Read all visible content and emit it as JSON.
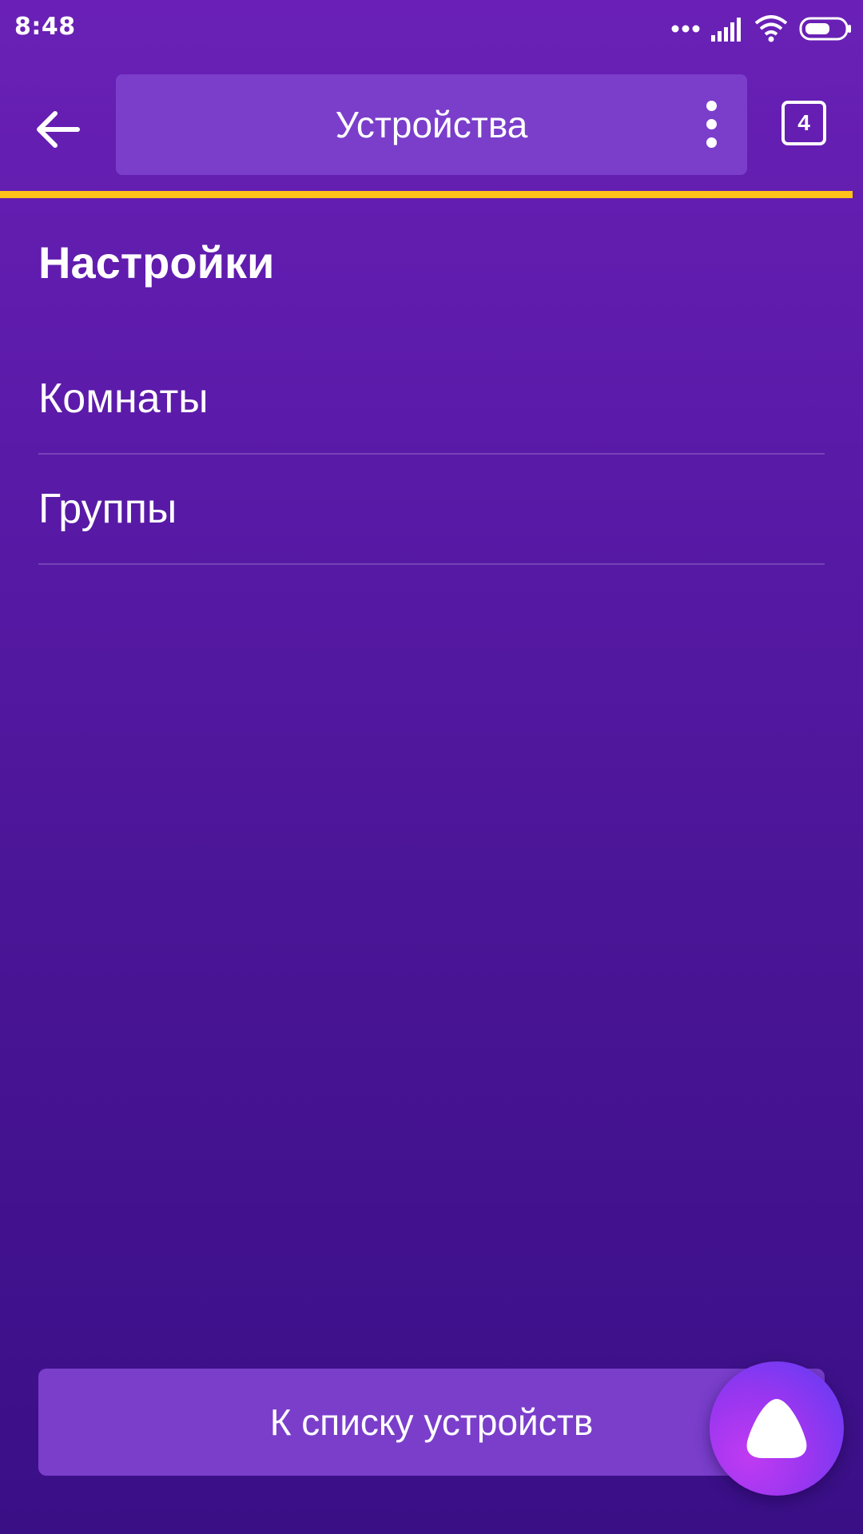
{
  "status_bar": {
    "time": "8:48"
  },
  "toolbar": {
    "title": "Устройства",
    "tabs_count": "4"
  },
  "accent_colors": {
    "background_top": "#6a20b6",
    "background_bottom": "#3a0f86",
    "pill": "#7a3ecb",
    "progress": "#ffc21a"
  },
  "settings": {
    "title": "Настройки",
    "items": [
      {
        "label": "Комнаты"
      },
      {
        "label": "Группы"
      }
    ]
  },
  "bottom_button": {
    "label": "К списку устройств"
  },
  "icons": {
    "back": "arrow-left-icon",
    "more": "more-vertical-icon",
    "assistant": "alice-icon"
  }
}
